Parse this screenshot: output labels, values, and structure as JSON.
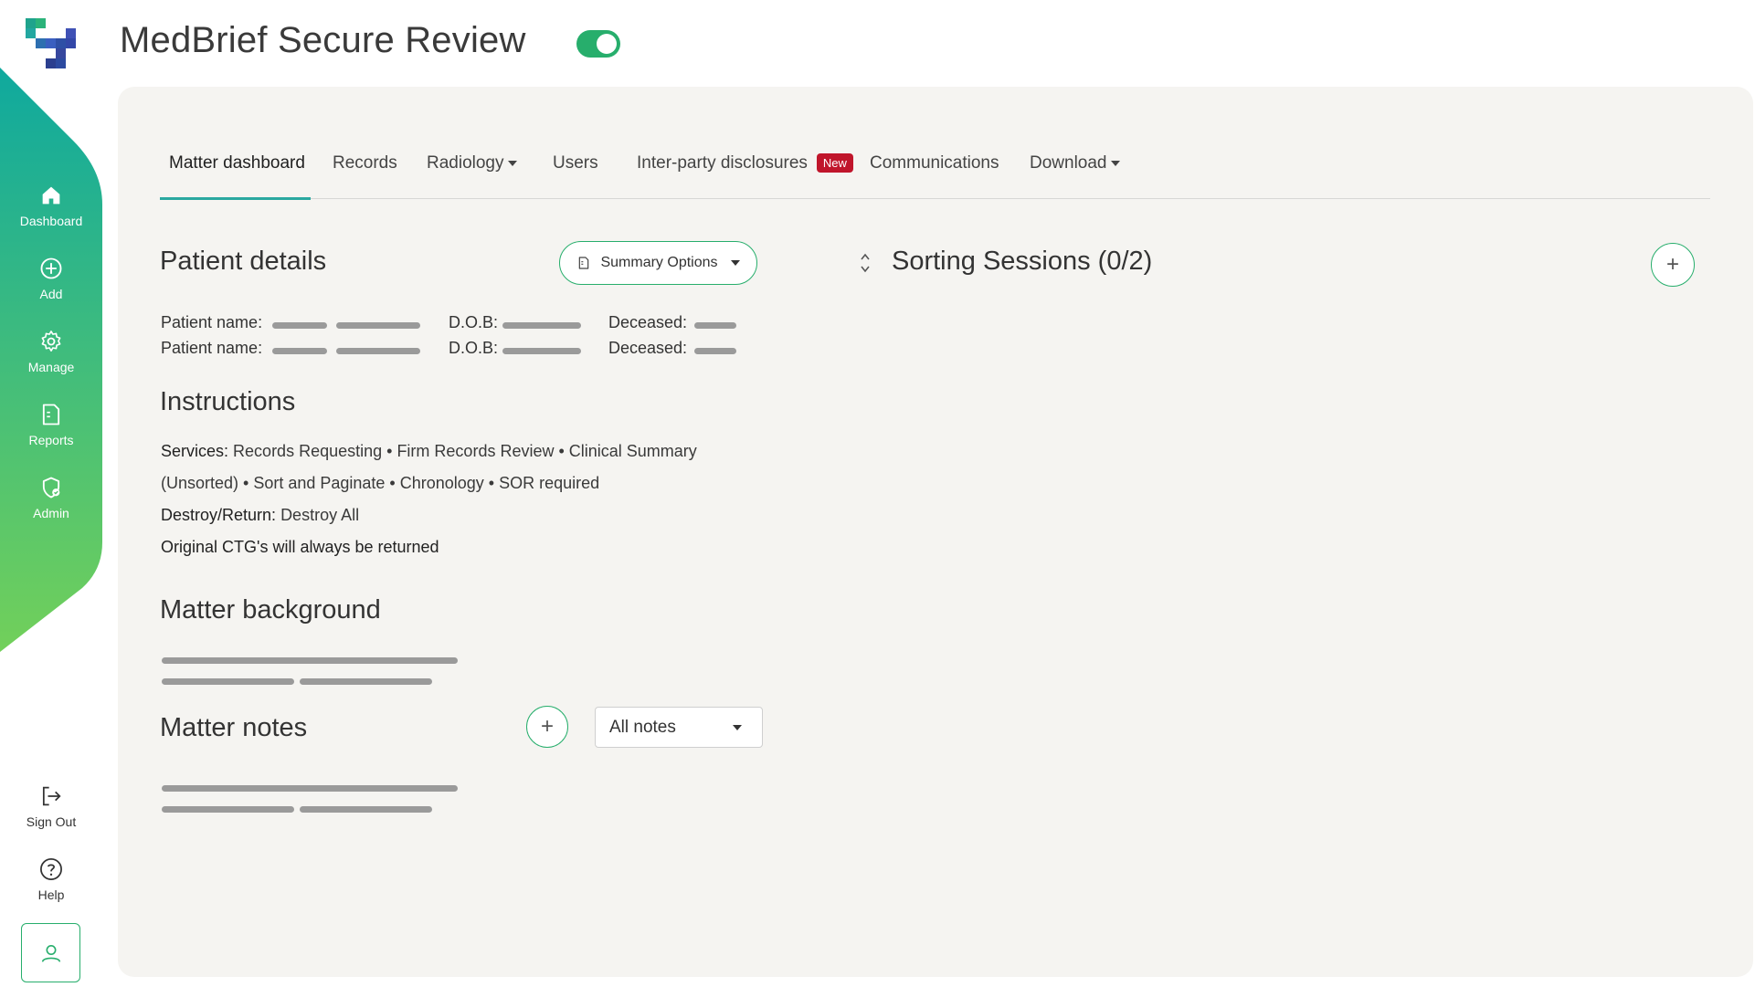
{
  "header": {
    "app_title": "MedBrief Secure Review",
    "toggle_on": true,
    "accent_color": "#27ae6c"
  },
  "sidebar": {
    "gradient": [
      "#12a99b",
      "#6bcf5b"
    ],
    "items": [
      {
        "label": "Dashboard",
        "icon": "home-icon"
      },
      {
        "label": "Add",
        "icon": "plus-circle-icon"
      },
      {
        "label": "Manage",
        "icon": "gear-icon"
      },
      {
        "label": "Reports",
        "icon": "report-icon"
      },
      {
        "label": "Admin",
        "icon": "shield-icon"
      }
    ],
    "bottom": [
      {
        "label": "Sign Out",
        "icon": "sign-out-icon"
      },
      {
        "label": "Help",
        "icon": "help-icon"
      }
    ],
    "user_icon": "user-icon"
  },
  "tabs": [
    {
      "label": "Matter dashboard",
      "active": true
    },
    {
      "label": "Records"
    },
    {
      "label": "Radiology",
      "dropdown": true
    },
    {
      "label": "Users"
    },
    {
      "label": "Inter-party disclosures",
      "badge": "New"
    },
    {
      "label": "Communications"
    },
    {
      "label": "Download",
      "dropdown": true
    }
  ],
  "patient_details": {
    "title": "Patient details",
    "summary_button": "Summary Options",
    "rows": [
      {
        "name_label": "Patient name:",
        "dob_label": "D.O.B:",
        "deceased_label": "Deceased:"
      },
      {
        "name_label": "Patient name:",
        "dob_label": "D.O.B:",
        "deceased_label": "Deceased:"
      }
    ]
  },
  "instructions": {
    "title": "Instructions",
    "services_label": "Services:",
    "services_line1": "Records Requesting • Firm Records Review • Clinical Summary",
    "services_line2": "(Unsorted) • Sort and Paginate • Chronology • SOR required",
    "destroy_label": "Destroy/Return:",
    "destroy_value": "Destroy All",
    "ctg_note": "Original CTG's will always be returned"
  },
  "matter_background": {
    "title": "Matter background"
  },
  "matter_notes": {
    "title": "Matter notes",
    "filter_value": "All notes"
  },
  "sorting_sessions": {
    "title": "Sorting Sessions (0/2)"
  }
}
